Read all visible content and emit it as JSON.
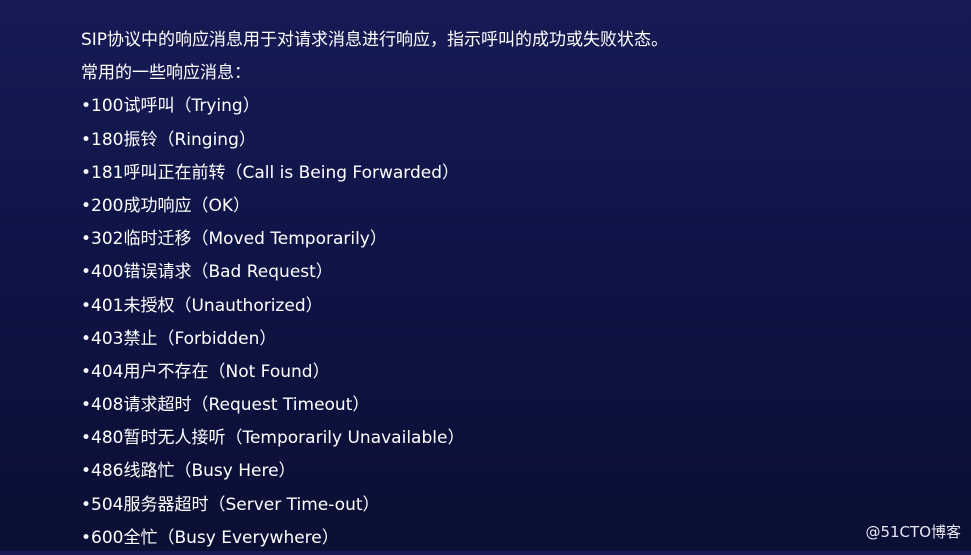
{
  "slide": {
    "intro": "SIP协议中的响应消息用于对请求消息进行响应，指示呼叫的成功或失败状态。",
    "subheading": "常用的一些响应消息：",
    "items": [
      "•100试呼叫（Trying）",
      "•180振铃（Ringing）",
      "•181呼叫正在前转（Call is Being Forwarded）",
      "•200成功响应（OK）",
      "•302临时迁移（Moved Temporarily）",
      "•400错误请求（Bad Request）",
      "•401未授权（Unauthorized）",
      "•403禁止（Forbidden）",
      "•404用户不存在（Not Found）",
      "•408请求超时（Request Timeout）",
      "•480暂时无人接听（Temporarily Unavailable）",
      "•486线路忙（Busy Here）",
      "•504服务器超时（Server Time-out）",
      "•600全忙（Busy Everywhere）"
    ]
  },
  "watermark": "@51CTO博客",
  "colors": {
    "background_top": "#161b55",
    "background_bottom": "#0a0f34",
    "text": "#ffffff"
  }
}
